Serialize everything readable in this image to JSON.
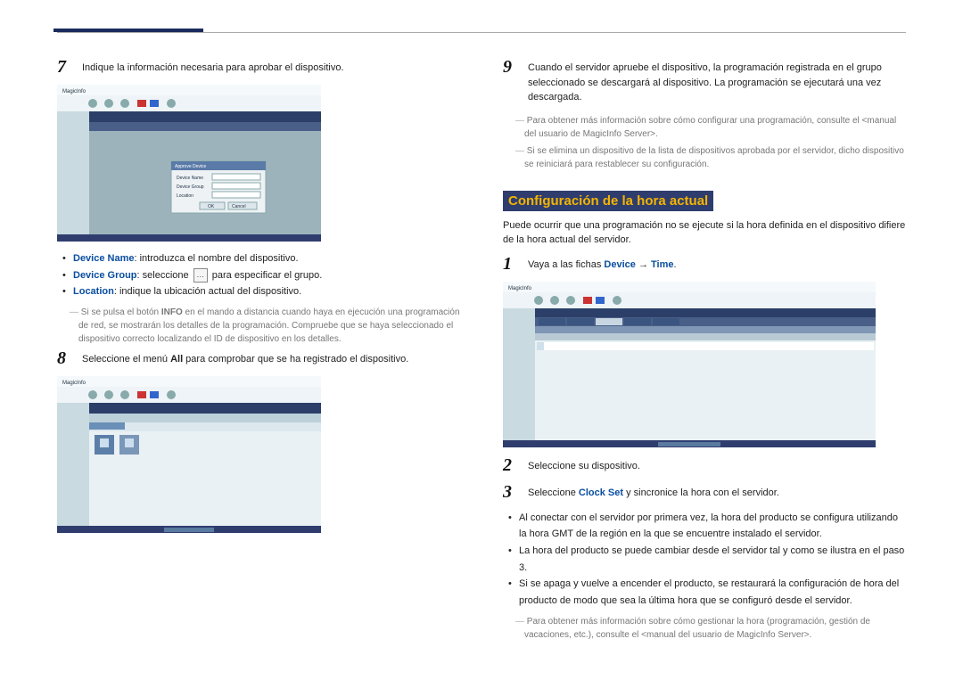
{
  "header": {},
  "left": {
    "step7": {
      "num": "7",
      "text": "Indique la información necesaria para aprobar el dispositivo."
    },
    "bullets7": [
      {
        "kw": "Device Name",
        "rest": ": introduzca el nombre del dispositivo."
      },
      {
        "kw": "Device Group",
        "rest_a": ": seleccione ",
        "rest_b": " para especificar el grupo."
      },
      {
        "kw": "Location",
        "rest": ": indique la ubicación actual del dispositivo."
      }
    ],
    "note7_a": "Si se pulsa el botón ",
    "note7_bold": "INFO",
    "note7_b": " en el mando a distancia cuando haya en ejecución una programación de red, se mostrarán los detalles de la programación. Compruebe que se haya seleccionado el dispositivo correcto localizando el ID de dispositivo en los detalles.",
    "step8": {
      "num": "8",
      "text_a": "Seleccione el menú ",
      "text_bold": "All",
      "text_b": " para comprobar que se ha registrado el dispositivo."
    }
  },
  "right": {
    "step9": {
      "num": "9",
      "text": "Cuando el servidor apruebe el dispositivo, la programación registrada en el grupo seleccionado se descargará al dispositivo. La programación se ejecutará una vez descargada."
    },
    "note9a": "Para obtener más información sobre cómo configurar una programación, consulte el <manual del usuario de MagicInfo Server>.",
    "note9b": "Si se elimina un dispositivo de la lista de dispositivos aprobada por el servidor, dicho dispositivo se reiniciará para restablecer su configuración.",
    "heading": "Configuración de la hora actual",
    "intro": "Puede ocurrir que una programación no se ejecute si la hora definida en el dispositivo difiere de la hora actual del servidor.",
    "step1": {
      "num": "1",
      "text_a": "Vaya a las fichas ",
      "kw1": "Device",
      "arrow": " → ",
      "kw2": "Time",
      "end": "."
    },
    "step2": {
      "num": "2",
      "text": "Seleccione su dispositivo."
    },
    "step3": {
      "num": "3",
      "text_a": "Seleccione ",
      "kw": "Clock Set",
      "text_b": " y sincronice la hora con el servidor."
    },
    "bullets3": [
      "Al conectar con el servidor por primera vez, la hora del producto se configura utilizando la hora GMT de la región en la que se encuentre instalado el servidor.",
      "La hora del producto se puede cambiar desde el servidor tal y como se ilustra en el paso 3.",
      "Si se apaga y vuelve a encender el producto, se restaurará la configuración de hora del producto de modo que sea la última hora que se configuró desde el servidor."
    ],
    "note3": "Para obtener más información sobre cómo gestionar la hora (programación, gestión de vacaciones, etc.), consulte el <manual del usuario de MagicInfo Server>."
  },
  "screenshot_labels": {
    "app": "MagicInfo",
    "dialog_title": "Approve Device",
    "field1": "Device Name",
    "field2": "Device Group",
    "field3": "Location",
    "ok": "OK",
    "cancel": "Cancel"
  }
}
